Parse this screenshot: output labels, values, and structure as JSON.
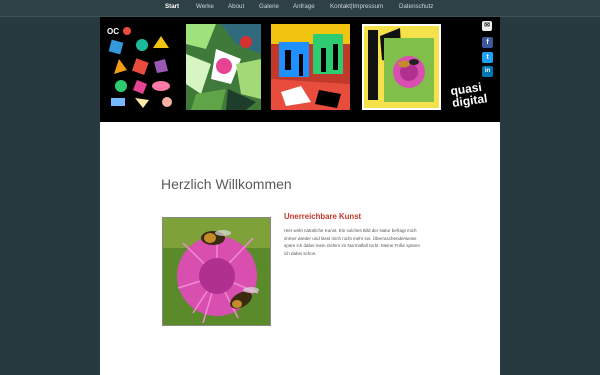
{
  "nav": {
    "items": [
      {
        "label": "Start",
        "active": true
      },
      {
        "label": "Werke",
        "active": false
      },
      {
        "label": "About",
        "active": false
      },
      {
        "label": "Galerie",
        "active": false
      },
      {
        "label": "Anfrage",
        "active": false
      },
      {
        "label": "Kontakt|Impressum",
        "active": false
      },
      {
        "label": "Datenschutz",
        "active": false
      }
    ]
  },
  "banner": {
    "logo_line1": "quasi",
    "logo_line2": "digital",
    "social": [
      "mail-icon",
      "facebook-icon",
      "twitter-icon",
      "linkedin-icon"
    ]
  },
  "main": {
    "title": "Herzlich Willkommen",
    "article": {
      "heading": "Unerreichbare Kunst",
      "text": "Hier wirkt natürliche Kunst. Ein solches Bild der Natur befragt mich immer wieder und lässt mich nicht mehr los. Überraschenderweise spüre ich dabei mein Gehirn im Normalfall nicht. Meine Füße spüren ich dabei schon."
    }
  },
  "colors": {
    "background": "#263a3f",
    "heading_accent": "#c0392b"
  }
}
